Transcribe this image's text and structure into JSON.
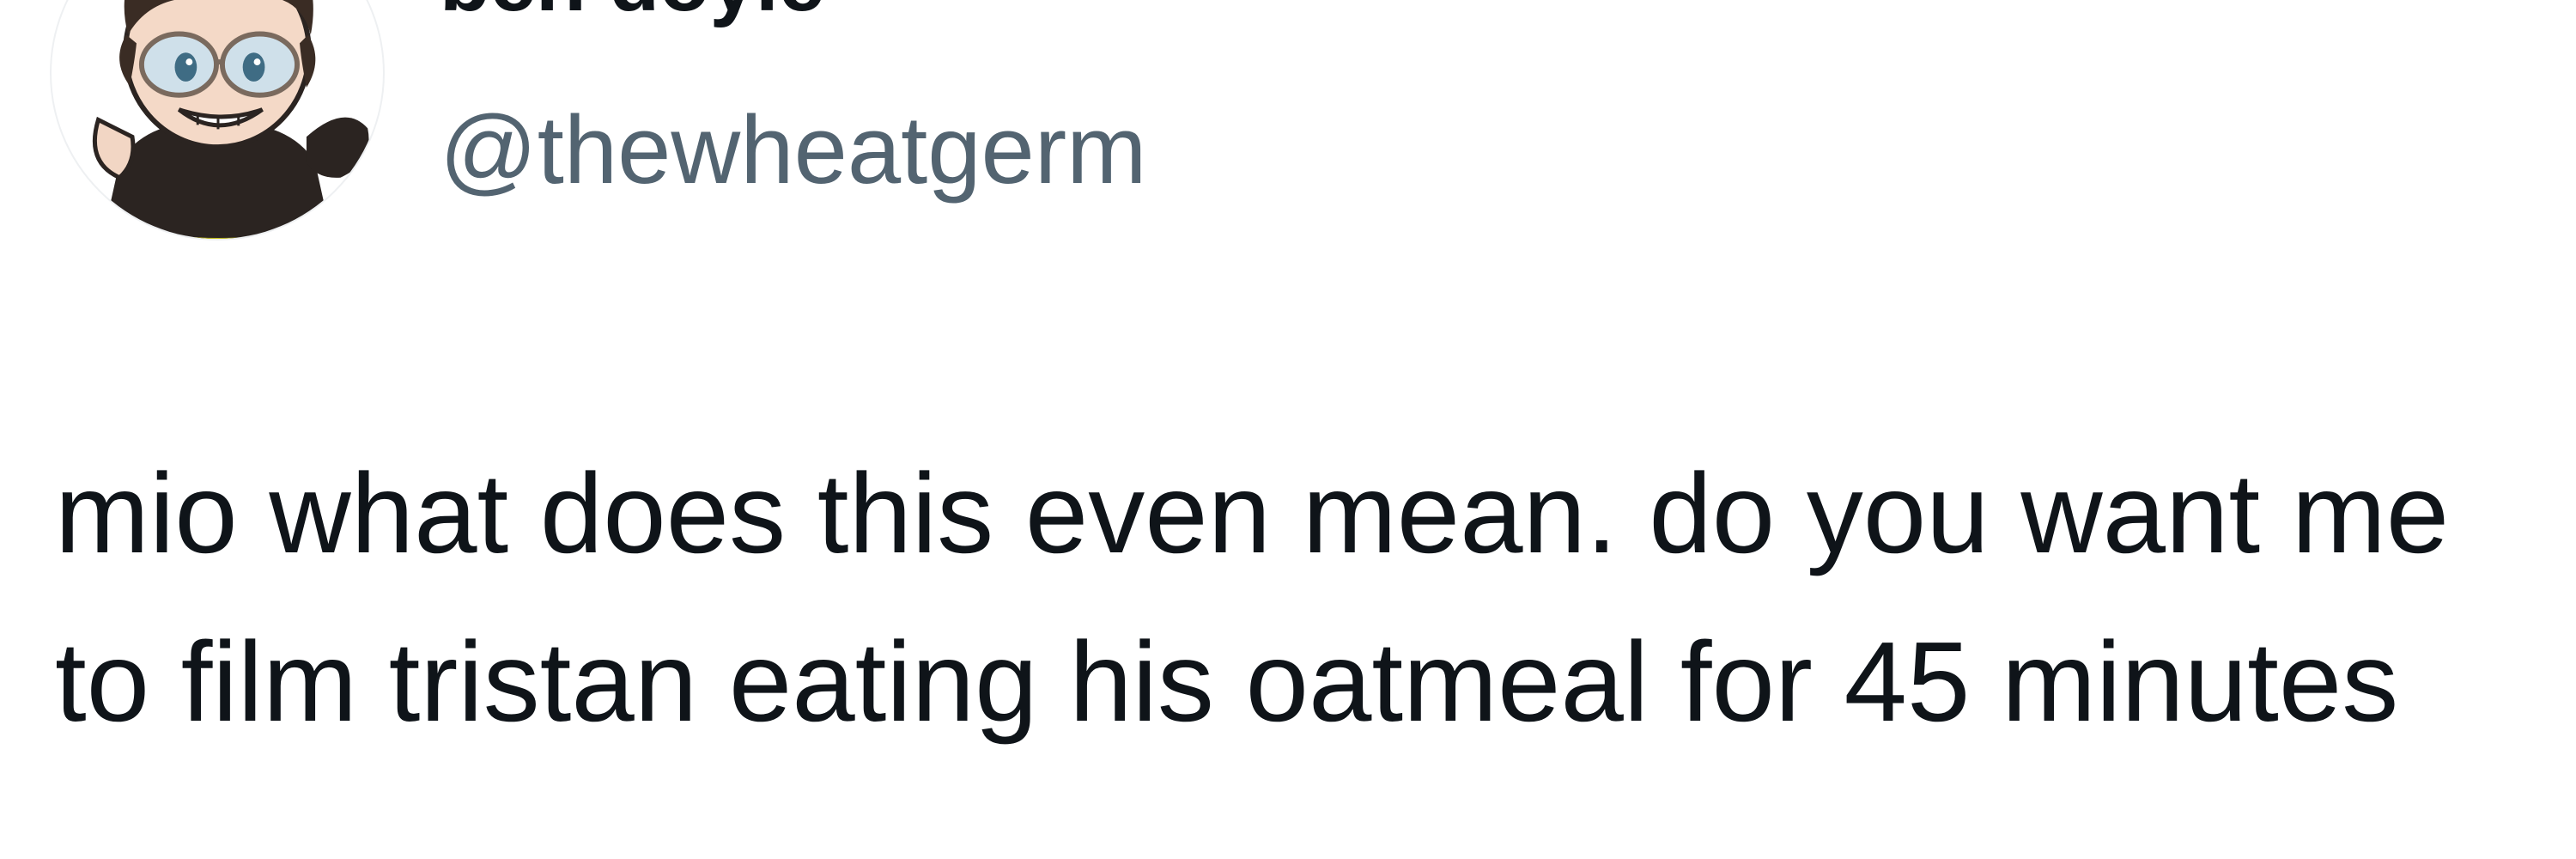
{
  "tweet": {
    "author": {
      "display_name": "ben doyle",
      "handle": "@thewheatgerm",
      "avatar_icon": "cartoon-avatar-icon"
    },
    "text": "mio what does this even mean. do you want me to film tristan eating his oatmeal for 45 minutes"
  },
  "colors": {
    "background": "#ffffff",
    "text_primary": "#0f1419",
    "text_secondary": "#536471"
  }
}
